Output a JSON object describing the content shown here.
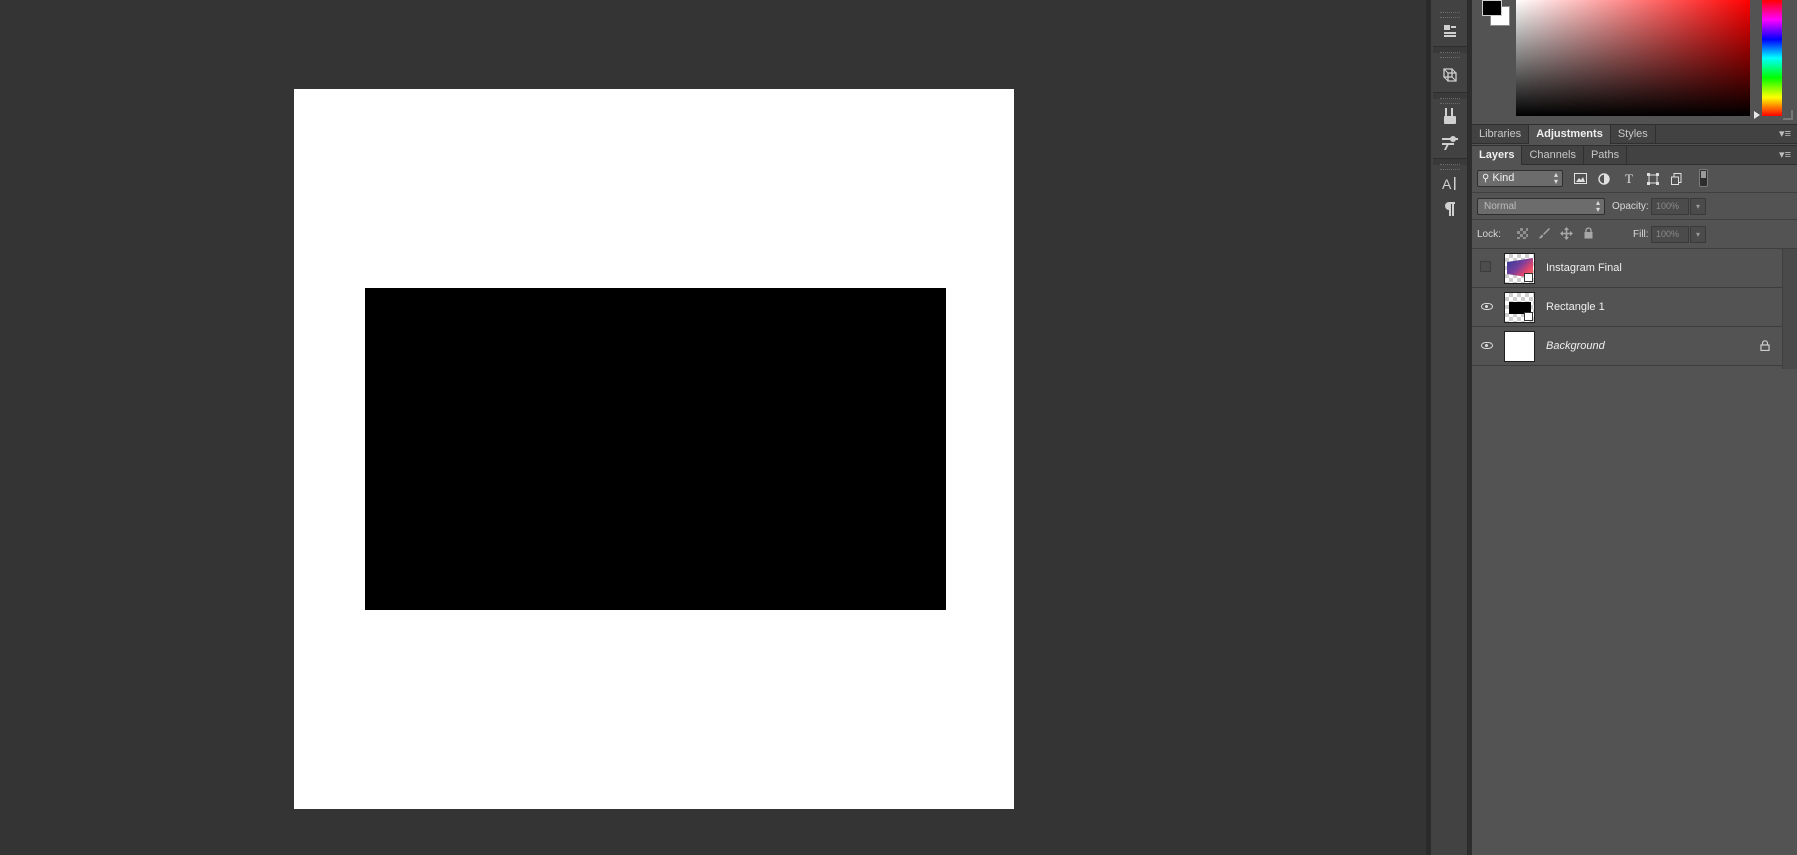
{
  "colors": {
    "workspace": "#343434",
    "panel": "#535353",
    "foreground": "#000000",
    "background": "#ffffff",
    "canvas": "#ffffff",
    "shape_fill": "#000000"
  },
  "icons": {
    "strip": [
      "properties-icon",
      "3d-icon",
      "brush-presets-icon",
      "tool-presets-icon",
      "character-icon",
      "paragraph-icon"
    ],
    "filters": [
      "image-filter-icon",
      "adjustment-filter-icon",
      "type-filter-icon",
      "shape-filter-icon",
      "smart-object-filter-icon"
    ],
    "locks": [
      "lock-transparent-pixels-icon",
      "lock-image-pixels-icon",
      "lock-position-icon",
      "lock-all-icon"
    ]
  },
  "top_tabs": [
    {
      "label": "Libraries",
      "active": false
    },
    {
      "label": "Adjustments",
      "active": true
    },
    {
      "label": "Styles",
      "active": false
    }
  ],
  "layer_tabs": [
    {
      "label": "Layers",
      "active": true
    },
    {
      "label": "Channels",
      "active": false
    },
    {
      "label": "Paths",
      "active": false
    }
  ],
  "layers_panel": {
    "filter_kind": "Kind",
    "blend_mode": "Normal",
    "opacity_label": "Opacity:",
    "opacity_value": "100%",
    "lock_label": "Lock:",
    "fill_label": "Fill:",
    "fill_value": "100%"
  },
  "layers": [
    {
      "name": "Instagram Final",
      "visible": false,
      "locked": false
    },
    {
      "name": "Rectangle 1",
      "visible": true,
      "locked": false
    },
    {
      "name": "Background",
      "visible": true,
      "locked": true
    }
  ]
}
